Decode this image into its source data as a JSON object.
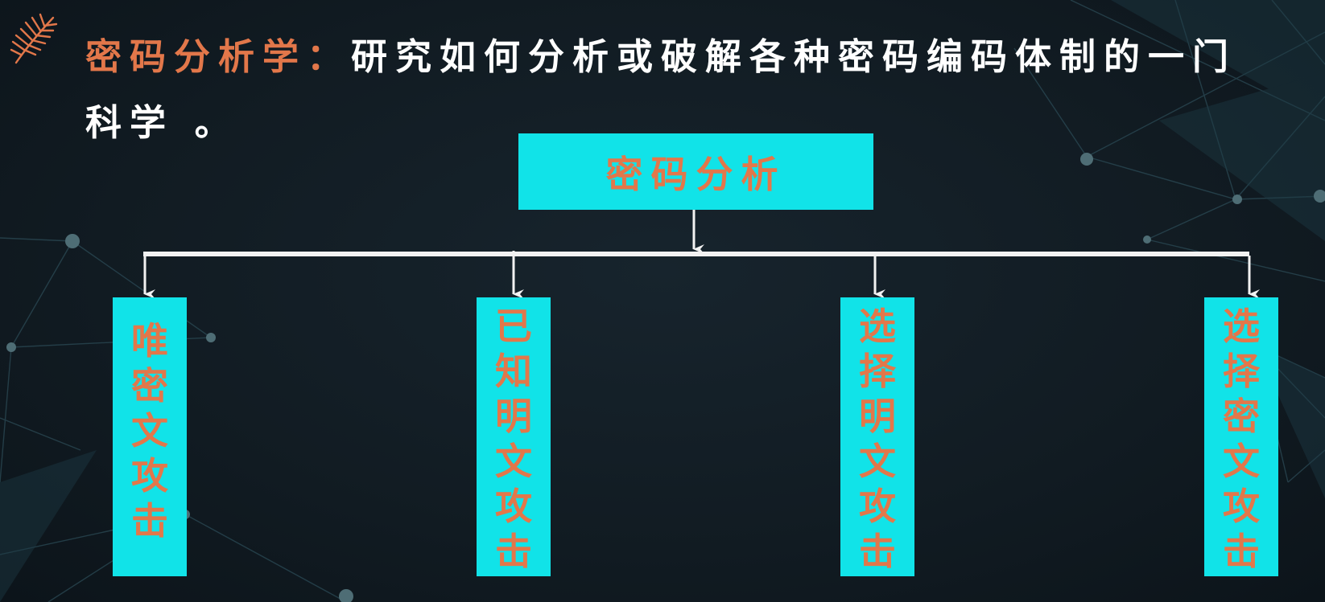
{
  "heading": {
    "term": "密码分析学：",
    "definition_line1": "研究如何分析或破解各种密码编码体制的一门",
    "definition_line2": "科学 。"
  },
  "diagram": {
    "root": {
      "label": "密码分析"
    },
    "children": [
      {
        "label": "唯密文攻击"
      },
      {
        "label": "已知明文攻击"
      },
      {
        "label": "选择明文攻击"
      },
      {
        "label": "选择密文攻击"
      }
    ]
  },
  "colors": {
    "background": "#131d25",
    "accent_orange": "#e2774a",
    "box_cyan": "#11e3e8",
    "line_white": "#f2f2f2"
  },
  "icons": {
    "logo": "feather-leaf-icon"
  }
}
